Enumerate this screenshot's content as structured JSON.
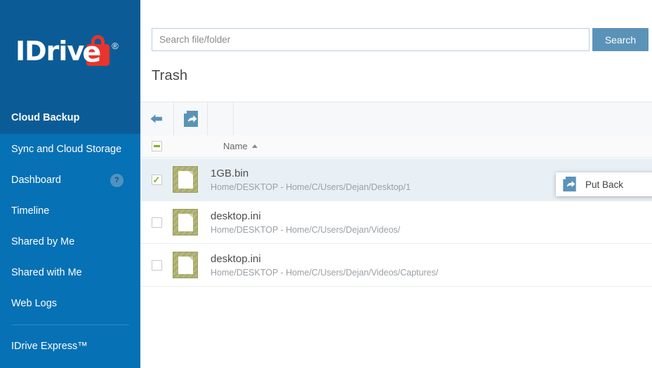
{
  "brand": {
    "name_part1": "IDriv",
    "name_e": "e",
    "registered": "®",
    "logo_blue": "#0b5c96",
    "logo_red": "#e8342c"
  },
  "sidebar": {
    "background": "#0671b5",
    "active_background": "#0b5c96",
    "items": [
      {
        "label": "Cloud Backup",
        "active": true,
        "badge": ""
      },
      {
        "label": "Sync and Cloud Storage",
        "active": false,
        "badge": ""
      },
      {
        "label": "Dashboard",
        "active": false,
        "badge": "?"
      },
      {
        "label": "Timeline",
        "active": false,
        "badge": ""
      },
      {
        "label": "Shared by Me",
        "active": false,
        "badge": ""
      },
      {
        "label": "Shared with Me",
        "active": false,
        "badge": ""
      },
      {
        "label": "Web Logs",
        "active": false,
        "badge": ""
      }
    ],
    "footer_item": {
      "label": "IDrive Express™"
    }
  },
  "search": {
    "value": "",
    "placeholder": "Search file/folder",
    "button_label": "Search",
    "button_color": "#5b93b8"
  },
  "page": {
    "title": "Trash"
  },
  "toolbar": {
    "buttons": [
      {
        "name": "back-button",
        "icon": "back-arrow-icon",
        "label": ""
      },
      {
        "name": "put-back-button",
        "icon": "put-back-icon",
        "label": ""
      }
    ],
    "icon_color": "#5b93b8"
  },
  "list": {
    "select_all_state": "indeterminate",
    "columns": [
      {
        "label": "Name",
        "sort": "asc"
      }
    ],
    "check_color": "#7fb520",
    "selected_row_background": "#e9f0f5",
    "rows": [
      {
        "name": "1GB.bin",
        "path": "Home/DESKTOP - Home/C/Users/Dejan/Desktop/1",
        "checked": true,
        "selected": true
      },
      {
        "name": "desktop.ini",
        "path": "Home/DESKTOP - Home/C/Users/Dejan/Videos/",
        "checked": false,
        "selected": false
      },
      {
        "name": "desktop.ini",
        "path": "Home/DESKTOP - Home/C/Users/Dejan/Videos/Captures/",
        "checked": false,
        "selected": false
      }
    ]
  },
  "context_menu": {
    "visible": true,
    "items": [
      {
        "label": "Put Back",
        "icon": "put-back-icon"
      }
    ]
  }
}
